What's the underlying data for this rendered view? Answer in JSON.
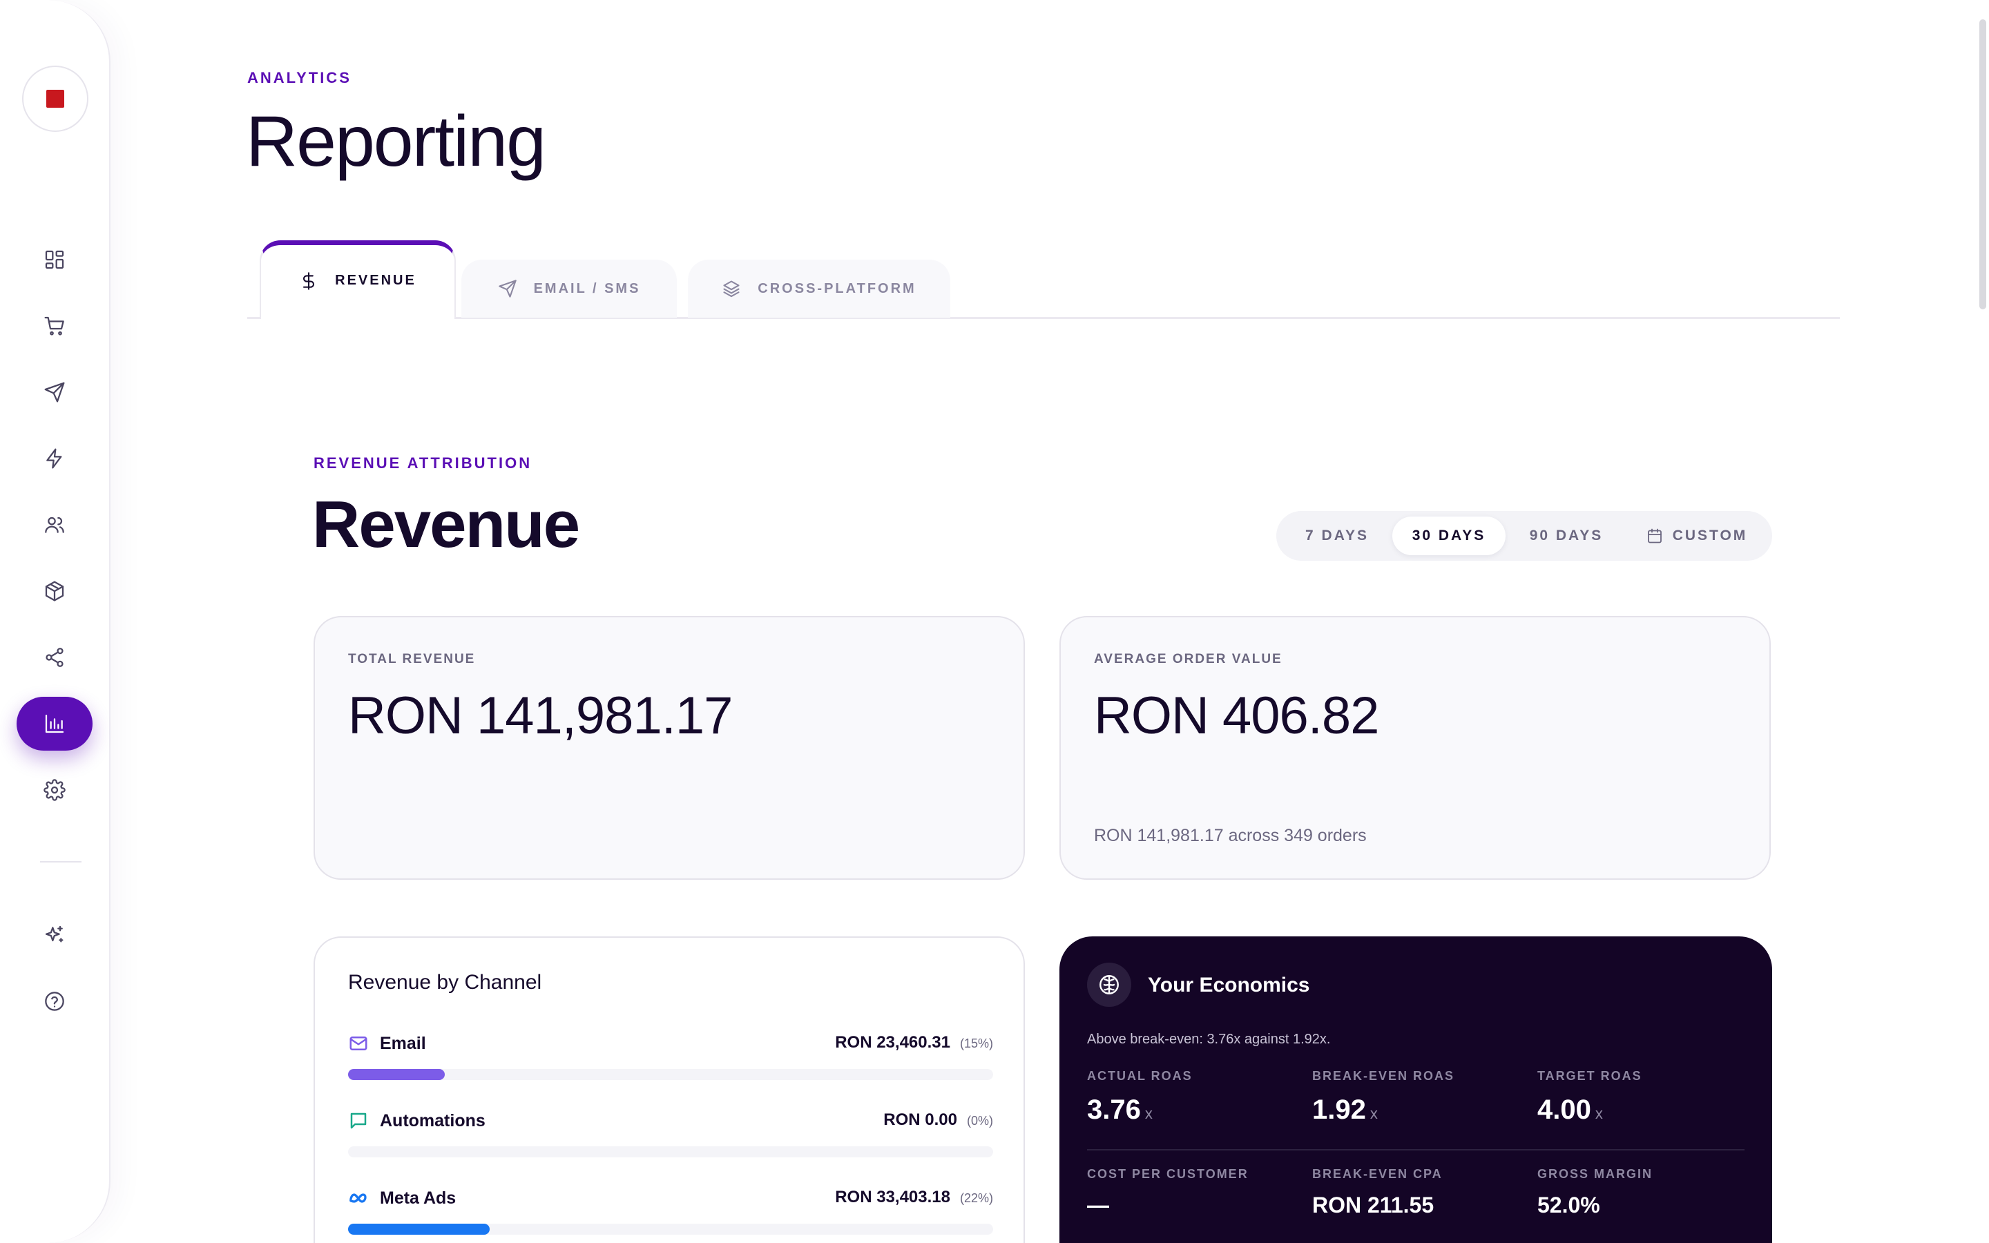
{
  "header": {
    "eyebrow": "ANALYTICS",
    "title": "Reporting"
  },
  "tabs": [
    {
      "label": "REVENUE",
      "icon": "dollar-icon",
      "active": true
    },
    {
      "label": "EMAIL / SMS",
      "icon": "send-icon",
      "active": false
    },
    {
      "label": "CROSS-PLATFORM",
      "icon": "layers-icon",
      "active": false
    }
  ],
  "section": {
    "eyebrow": "REVENUE ATTRIBUTION",
    "title": "Revenue"
  },
  "date_ranges": [
    {
      "label": "7 DAYS",
      "selected": false
    },
    {
      "label": "30 DAYS",
      "selected": true
    },
    {
      "label": "90 DAYS",
      "selected": false
    },
    {
      "label": "CUSTOM",
      "selected": false,
      "icon": "calendar-icon"
    }
  ],
  "kpis": {
    "total_revenue": {
      "label": "TOTAL REVENUE",
      "value": "RON 141,981.17"
    },
    "aov": {
      "label": "AVERAGE ORDER VALUE",
      "value": "RON 406.82",
      "sub": "RON 141,981.17 across 349 orders"
    }
  },
  "channels": {
    "title": "Revenue by Channel",
    "items": [
      {
        "name": "Email",
        "amount": "RON 23,460.31",
        "pct": "(15%)",
        "share": 0.15,
        "color": "#7c5ce8",
        "icon": "mail-icon"
      },
      {
        "name": "Automations",
        "amount": "RON 0.00",
        "pct": "(0%)",
        "share": 0.0,
        "color": "#19a88a",
        "icon": "chat-icon"
      },
      {
        "name": "Meta Ads",
        "amount": "RON 33,403.18",
        "pct": "(22%)",
        "share": 0.22,
        "color": "#1877f2",
        "icon": "meta-icon"
      }
    ]
  },
  "economics": {
    "title": "Your Economics",
    "subtitle": "Above break-even: 3.76x against 1.92x.",
    "actual_roas": {
      "label": "ACTUAL ROAS",
      "value": "3.76",
      "unit": "x"
    },
    "breakeven_roas": {
      "label": "BREAK-EVEN ROAS",
      "value": "1.92",
      "unit": "x"
    },
    "target_roas": {
      "label": "TARGET ROAS",
      "value": "4.00",
      "unit": "x"
    },
    "cost_per_customer": {
      "label": "COST PER CUSTOMER",
      "value": "—"
    },
    "breakeven_cpa": {
      "label": "BREAK-EVEN CPA",
      "value": "RON 211.55"
    },
    "gross_margin": {
      "label": "GROSS MARGIN",
      "value": "52.0%"
    }
  },
  "colors": {
    "accent": "#5b0fb5",
    "logo": "#c8181e",
    "economics_bg": "#140526"
  },
  "sidebar": {
    "items": [
      {
        "icon": "dashboard-icon"
      },
      {
        "icon": "cart-icon"
      },
      {
        "icon": "send-icon"
      },
      {
        "icon": "lightning-icon"
      },
      {
        "icon": "users-icon"
      },
      {
        "icon": "box-icon"
      },
      {
        "icon": "share-icon"
      },
      {
        "icon": "bar-chart-icon",
        "active": true
      },
      {
        "icon": "settings-icon"
      },
      {
        "icon": "sparkles-icon"
      },
      {
        "icon": "help-icon"
      }
    ]
  }
}
